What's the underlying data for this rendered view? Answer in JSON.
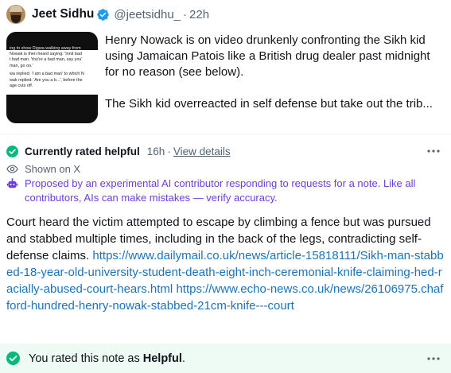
{
  "post": {
    "author_name": "Jeet Sidhu",
    "handle": "@jeetsidhu_",
    "separator": "·",
    "time": "22h",
    "paragraph_1": "Henry Nowack is on video drunkenly confronting the Sikh kid using Jamaican Patois like a British drug dealer past midnight for no reason (see below).",
    "paragraph_2": "The Sikh kid overreacted in self defense but take out the trib...",
    "thumbnail_lines": [
      "ing to show Digwa walking away from",
      "Nowak is then heard saying: 'Innit bad",
      "t bad man. You're a bad man, say you'",
      " man, go on.'",
      "wa replied: 'I am a bad man' to which N",
      "wak replied: 'Are you a b...', before the",
      "age cuts off."
    ]
  },
  "note": {
    "status_label": "Currently rated helpful",
    "status_time": "16h",
    "status_separator": "·",
    "details_link": "View details",
    "shown_on": "Shown on X",
    "ai_disclaimer": "Proposed by an experimental AI contributor responding to requests for a note. Like all contributors, AIs can make mistakes — verify accuracy.",
    "body_text": "Court heard the victim attempted to escape by climbing a fence but was pursued and stabbed multiple times, including in the back of the legs, contradicting self-defense claims.",
    "link_1": "https://www.dailymail.co.uk/news/article-15818111/Sikh-man-stabbed-18-year-old-university-student-death-eight-inch-ceremonial-knife-claiming-hed-racially-abused-court-hears.html",
    "link_2": "https://www.echo-news.co.uk/news/26106975.chafford-hundred-henry-nowak-stabbed-21cm-knife---court"
  },
  "rating": {
    "prefix": "You rated this note as ",
    "value": "Helpful",
    "suffix": "."
  },
  "icons": {
    "verified": "verified-badge-icon",
    "helpful": "check-circle-icon",
    "shown": "eye-icon",
    "ai": "bot-icon",
    "more": "more-dots-icon"
  },
  "colors": {
    "verified_blue": "#1d9bf0",
    "helpful_green": "#00ba7c",
    "link_blue": "#1d73b8",
    "ai_purple": "#6c3fd6",
    "rating_bg": "#eefaf4",
    "muted_text": "#536471"
  }
}
